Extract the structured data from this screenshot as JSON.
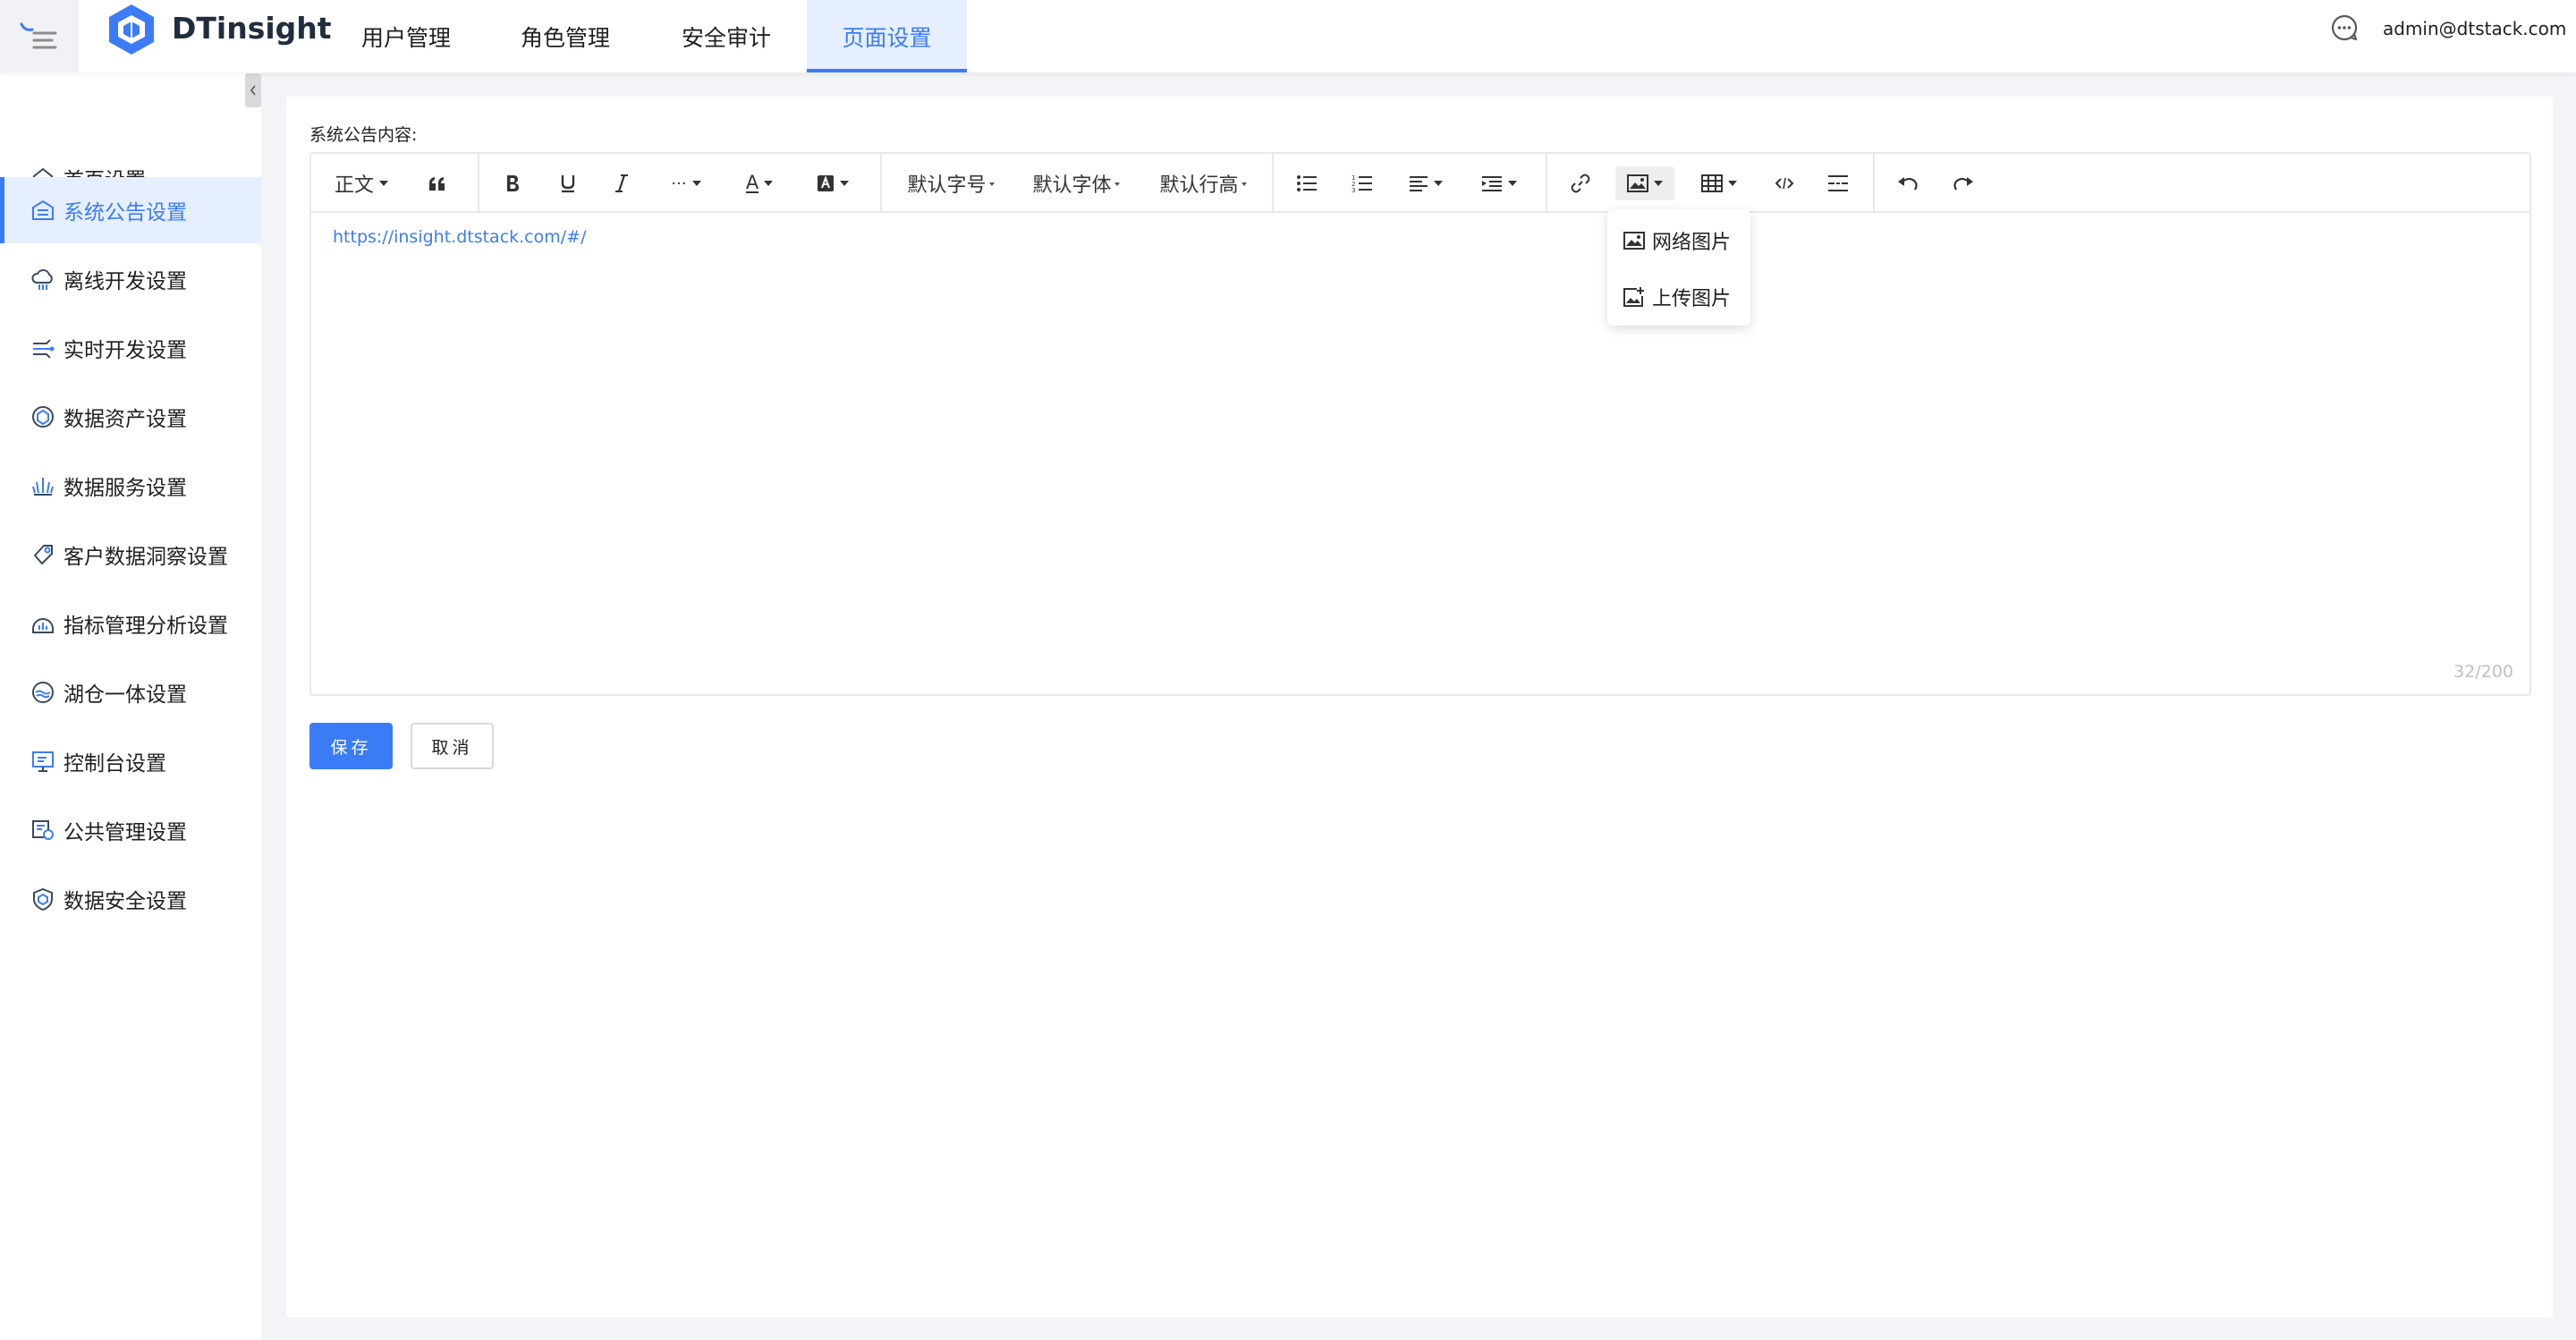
{
  "header": {
    "logo_text": "DTinsight",
    "nav": [
      {
        "label": "用户管理"
      },
      {
        "label": "角色管理"
      },
      {
        "label": "安全审计"
      },
      {
        "label": "页面设置",
        "active": true
      }
    ],
    "user_email": "admin@dtstack.com"
  },
  "sidebar": {
    "items": [
      {
        "label": "首页设置",
        "icon": "home-settings-icon"
      },
      {
        "label": "系统公告设置",
        "icon": "announcement-icon",
        "active": true
      },
      {
        "label": "离线开发设置",
        "icon": "cloud-dev-icon"
      },
      {
        "label": "实时开发设置",
        "icon": "realtime-icon"
      },
      {
        "label": "数据资产设置",
        "icon": "data-asset-icon"
      },
      {
        "label": "数据服务设置",
        "icon": "data-service-icon"
      },
      {
        "label": "客户数据洞察设置",
        "icon": "customer-insight-icon"
      },
      {
        "label": "指标管理分析设置",
        "icon": "metrics-icon"
      },
      {
        "label": "湖仓一体设置",
        "icon": "lakehouse-icon"
      },
      {
        "label": "控制台设置",
        "icon": "console-icon"
      },
      {
        "label": "公共管理设置",
        "icon": "public-mgmt-icon"
      },
      {
        "label": "数据安全设置",
        "icon": "data-security-icon"
      }
    ]
  },
  "form": {
    "label": "系统公告内容:",
    "content": "https://insight.dtstack.com/#/",
    "char_count": "32/200"
  },
  "toolbar": {
    "paragraph": "正文",
    "font_size": "默认字号",
    "font_family": "默认字体",
    "line_height": "默认行高",
    "more": "···",
    "font_color": "A"
  },
  "image_menu": {
    "items": [
      {
        "label": "网络图片",
        "icon": "image-icon"
      },
      {
        "label": "上传图片",
        "icon": "upload-image-icon"
      }
    ]
  },
  "buttons": {
    "save": "保存",
    "cancel": "取消"
  },
  "colors": {
    "accent": "#3b7cf6",
    "active_bg": "#e6efff"
  }
}
